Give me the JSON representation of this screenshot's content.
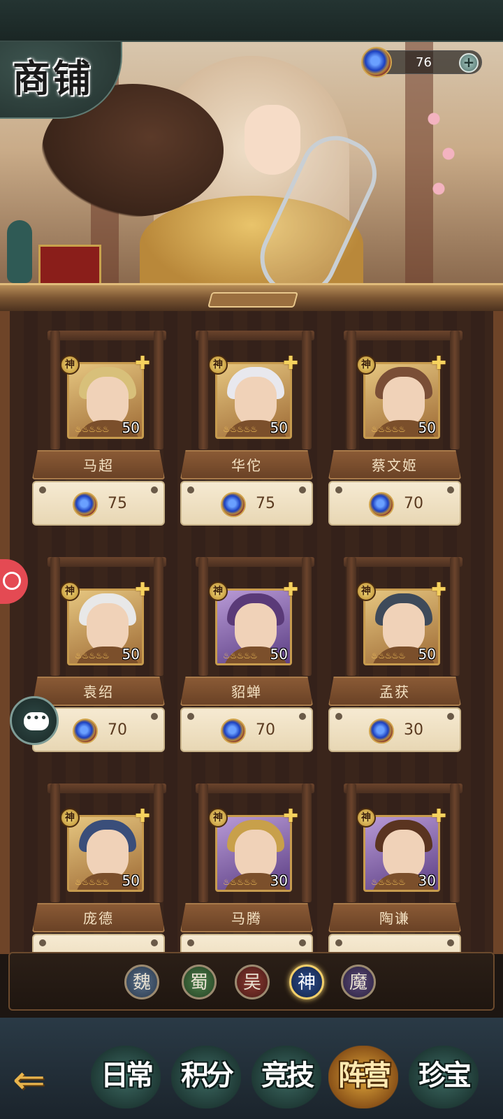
{
  "shop": {
    "title": "商铺",
    "currency": {
      "amount": "76",
      "icon": "jade-gem-icon",
      "plus_label": "+"
    }
  },
  "cards": [
    {
      "name": "马超",
      "price": "75",
      "level": "50",
      "stars": "5",
      "god_badge": "神"
    },
    {
      "name": "华佗",
      "price": "75",
      "level": "50",
      "stars": "5",
      "god_badge": "神"
    },
    {
      "name": "蔡文姬",
      "price": "70",
      "level": "50",
      "stars": "5",
      "god_badge": "神"
    },
    {
      "name": "袁绍",
      "price": "70",
      "level": "50",
      "stars": "5",
      "god_badge": "神"
    },
    {
      "name": "貂蝉",
      "price": "70",
      "level": "50",
      "stars": "5",
      "god_badge": "神"
    },
    {
      "name": "孟获",
      "price": "30",
      "level": "50",
      "stars": "5",
      "god_badge": "神"
    },
    {
      "name": "庞德",
      "price": "",
      "level": "50",
      "stars": "5",
      "god_badge": "神"
    },
    {
      "name": "马腾",
      "price": "",
      "level": "30",
      "stars": "5",
      "god_badge": "神"
    },
    {
      "name": "陶谦",
      "price": "",
      "level": "30",
      "stars": "5",
      "god_badge": "神"
    }
  ],
  "factions": [
    {
      "label": "魏"
    },
    {
      "label": "蜀"
    },
    {
      "label": "吴"
    },
    {
      "label": "神",
      "selected": true
    },
    {
      "label": "魔"
    }
  ],
  "nav": {
    "back_icon": "back-arrow-icon",
    "tabs": [
      {
        "label": "日常"
      },
      {
        "label": "积分"
      },
      {
        "label": "竞技"
      },
      {
        "label": "阵营",
        "active": true
      },
      {
        "label": "珍宝"
      }
    ]
  },
  "colors": {
    "accent_gold": "#d2a64e",
    "active_ring": "#f2cf6a",
    "record_button": "#e44a53"
  }
}
